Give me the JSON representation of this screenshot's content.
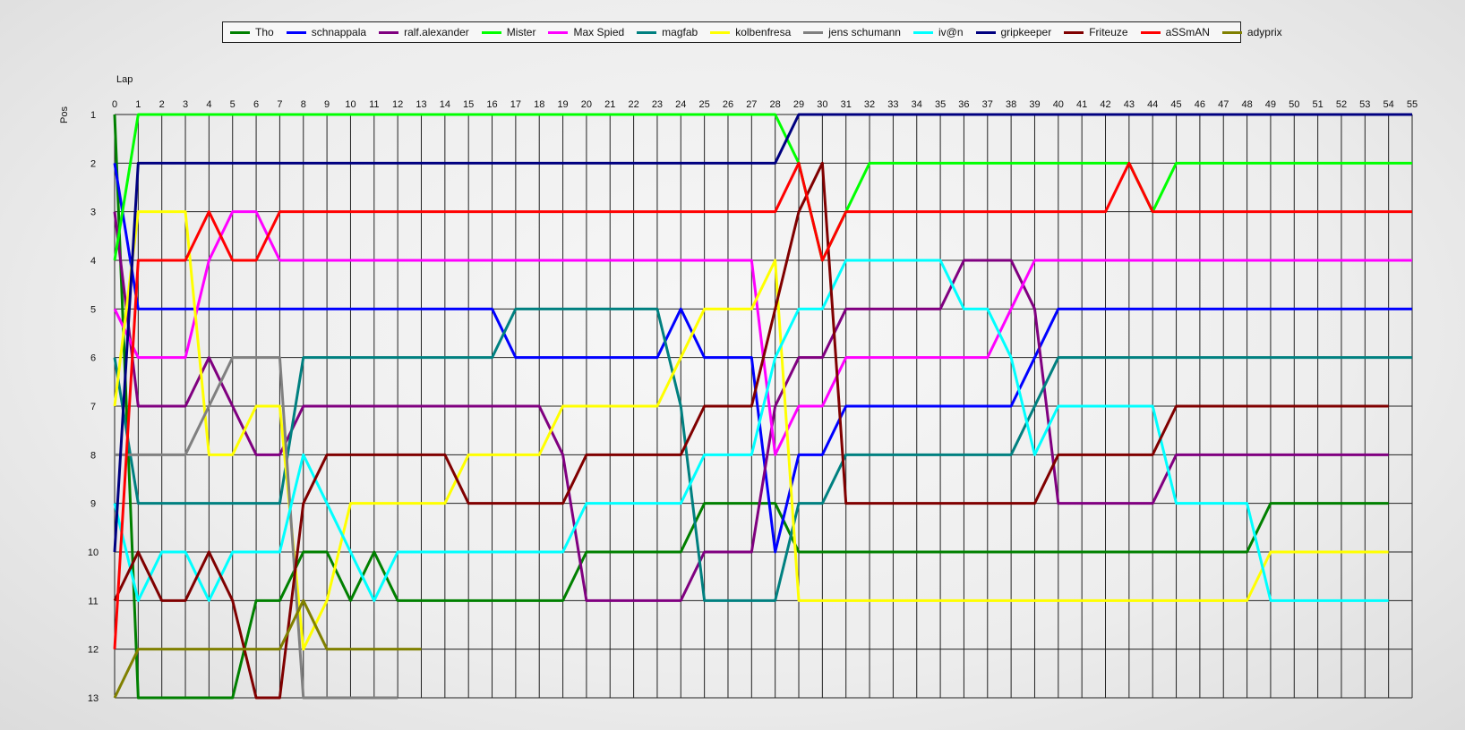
{
  "chart_data": {
    "type": "line",
    "xlabel": "Lap",
    "ylabel": "Pos",
    "xlim": [
      0,
      55
    ],
    "ylim": [
      1,
      13
    ],
    "y_inverted": true,
    "grid": true,
    "legend_position": "top",
    "x": [
      0,
      1,
      2,
      3,
      4,
      5,
      6,
      7,
      8,
      9,
      10,
      11,
      12,
      13,
      14,
      15,
      16,
      17,
      18,
      19,
      20,
      21,
      22,
      23,
      24,
      25,
      26,
      27,
      28,
      29,
      30,
      31,
      32,
      33,
      34,
      35,
      36,
      37,
      38,
      39,
      40,
      41,
      42,
      43,
      44,
      45,
      46,
      47,
      48,
      49,
      50,
      51,
      52,
      53,
      54,
      55
    ],
    "series": [
      {
        "name": "Tho",
        "color": "#008000",
        "values": [
          1,
          13,
          13,
          13,
          13,
          13,
          11,
          11,
          10,
          10,
          11,
          10,
          11,
          11,
          11,
          11,
          11,
          11,
          11,
          11,
          10,
          10,
          10,
          10,
          10,
          9,
          9,
          9,
          9,
          10,
          10,
          10,
          10,
          10,
          10,
          10,
          10,
          10,
          10,
          10,
          10,
          10,
          10,
          10,
          10,
          10,
          10,
          10,
          10,
          9,
          9,
          9,
          9,
          9,
          9
        ]
      },
      {
        "name": "schnappala",
        "color": "#0000ff",
        "values": [
          2,
          5,
          5,
          5,
          5,
          5,
          5,
          5,
          5,
          5,
          5,
          5,
          5,
          5,
          5,
          5,
          5,
          6,
          6,
          6,
          6,
          6,
          6,
          6,
          5,
          6,
          6,
          6,
          10,
          8,
          8,
          7,
          7,
          7,
          7,
          7,
          7,
          7,
          7,
          6,
          5,
          5,
          5,
          5,
          5,
          5,
          5,
          5,
          5,
          5,
          5,
          5,
          5,
          5,
          5,
          5
        ]
      },
      {
        "name": "ralf.alexander",
        "color": "#800080",
        "values": [
          3,
          7,
          7,
          7,
          6,
          7,
          8,
          8,
          7,
          7,
          7,
          7,
          7,
          7,
          7,
          7,
          7,
          7,
          7,
          8,
          11,
          11,
          11,
          11,
          11,
          10,
          10,
          10,
          7,
          6,
          6,
          5,
          5,
          5,
          5,
          5,
          4,
          4,
          4,
          5,
          9,
          9,
          9,
          9,
          9,
          8,
          8,
          8,
          8,
          8,
          8,
          8,
          8,
          8,
          8
        ]
      },
      {
        "name": "Mister",
        "color": "#00ff00",
        "values": [
          4,
          1,
          1,
          1,
          1,
          1,
          1,
          1,
          1,
          1,
          1,
          1,
          1,
          1,
          1,
          1,
          1,
          1,
          1,
          1,
          1,
          1,
          1,
          1,
          1,
          1,
          1,
          1,
          1,
          2,
          4,
          3,
          2,
          2,
          2,
          2,
          2,
          2,
          2,
          2,
          2,
          2,
          2,
          2,
          3,
          2,
          2,
          2,
          2,
          2,
          2,
          2,
          2,
          2,
          2,
          2
        ]
      },
      {
        "name": "Max Spied",
        "color": "#ff00ff",
        "values": [
          5,
          6,
          6,
          6,
          4,
          3,
          3,
          4,
          4,
          4,
          4,
          4,
          4,
          4,
          4,
          4,
          4,
          4,
          4,
          4,
          4,
          4,
          4,
          4,
          4,
          4,
          4,
          4,
          8,
          7,
          7,
          6,
          6,
          6,
          6,
          6,
          6,
          6,
          5,
          4,
          4,
          4,
          4,
          4,
          4,
          4,
          4,
          4,
          4,
          4,
          4,
          4,
          4,
          4,
          4,
          4
        ]
      },
      {
        "name": "magfab",
        "color": "#008080",
        "values": [
          6,
          9,
          9,
          9,
          9,
          9,
          9,
          9,
          6,
          6,
          6,
          6,
          6,
          6,
          6,
          6,
          6,
          5,
          5,
          5,
          5,
          5,
          5,
          5,
          7,
          11,
          11,
          11,
          11,
          9,
          9,
          8,
          8,
          8,
          8,
          8,
          8,
          8,
          8,
          7,
          6,
          6,
          6,
          6,
          6,
          6,
          6,
          6,
          6,
          6,
          6,
          6,
          6,
          6,
          6,
          6
        ]
      },
      {
        "name": "kolbenfresa",
        "color": "#ffff00",
        "values": [
          7,
          3,
          3,
          3,
          8,
          8,
          7,
          7,
          12,
          11,
          9,
          9,
          9,
          9,
          9,
          8,
          8,
          8,
          8,
          7,
          7,
          7,
          7,
          7,
          6,
          5,
          5,
          5,
          4,
          11,
          11,
          11,
          11,
          11,
          11,
          11,
          11,
          11,
          11,
          11,
          11,
          11,
          11,
          11,
          11,
          11,
          11,
          11,
          11,
          10,
          10,
          10,
          10,
          10,
          10
        ]
      },
      {
        "name": "jens  schumann",
        "color": "#808080",
        "values": [
          8,
          8,
          8,
          8,
          7,
          6,
          6,
          6,
          13,
          13,
          13,
          13,
          13
        ]
      },
      {
        "name": "iv@n",
        "color": "#00ffff",
        "values": [
          9,
          11,
          10,
          10,
          11,
          10,
          10,
          10,
          8,
          9,
          10,
          11,
          10,
          10,
          10,
          10,
          10,
          10,
          10,
          10,
          9,
          9,
          9,
          9,
          9,
          8,
          8,
          8,
          6,
          5,
          5,
          4,
          4,
          4,
          4,
          4,
          5,
          5,
          6,
          8,
          7,
          7,
          7,
          7,
          7,
          9,
          9,
          9,
          9,
          11,
          11,
          11,
          11,
          11,
          11
        ]
      },
      {
        "name": "gripkeeper",
        "color": "#000080",
        "values": [
          10,
          2,
          2,
          2,
          2,
          2,
          2,
          2,
          2,
          2,
          2,
          2,
          2,
          2,
          2,
          2,
          2,
          2,
          2,
          2,
          2,
          2,
          2,
          2,
          2,
          2,
          2,
          2,
          2,
          1,
          1,
          1,
          1,
          1,
          1,
          1,
          1,
          1,
          1,
          1,
          1,
          1,
          1,
          1,
          1,
          1,
          1,
          1,
          1,
          1,
          1,
          1,
          1,
          1,
          1,
          1
        ]
      },
      {
        "name": "Friteuze",
        "color": "#800000",
        "values": [
          11,
          10,
          11,
          11,
          10,
          11,
          13,
          13,
          9,
          8,
          8,
          8,
          8,
          8,
          8,
          9,
          9,
          9,
          9,
          9,
          8,
          8,
          8,
          8,
          8,
          7,
          7,
          7,
          5,
          3,
          2,
          9,
          9,
          9,
          9,
          9,
          9,
          9,
          9,
          9,
          8,
          8,
          8,
          8,
          8,
          7,
          7,
          7,
          7,
          7,
          7,
          7,
          7,
          7,
          7
        ]
      },
      {
        "name": "aSSmAN",
        "color": "#ff0000",
        "values": [
          12,
          4,
          4,
          4,
          3,
          4,
          4,
          3,
          3,
          3,
          3,
          3,
          3,
          3,
          3,
          3,
          3,
          3,
          3,
          3,
          3,
          3,
          3,
          3,
          3,
          3,
          3,
          3,
          3,
          2,
          4,
          3,
          3,
          3,
          3,
          3,
          3,
          3,
          3,
          3,
          3,
          3,
          3,
          2,
          3,
          3,
          3,
          3,
          3,
          3,
          3,
          3,
          3,
          3,
          3,
          3
        ]
      },
      {
        "name": "adyprix",
        "color": "#808000",
        "values": [
          13,
          12,
          12,
          12,
          12,
          12,
          12,
          12,
          11,
          12,
          12,
          12,
          12,
          12
        ]
      }
    ]
  }
}
